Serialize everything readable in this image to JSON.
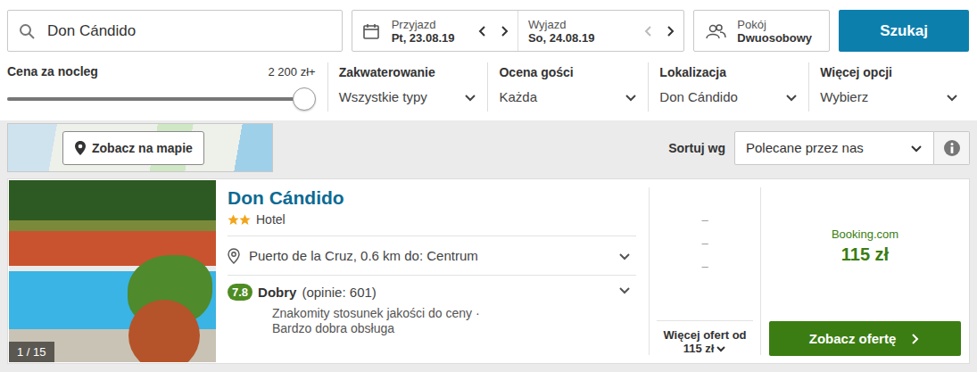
{
  "search": {
    "query": "Don Cándido"
  },
  "dates": [
    {
      "label": "Przyjazd",
      "value": "Pt, 23.08.19",
      "prev_disabled": false
    },
    {
      "label": "Wyjazd",
      "value": "So, 24.08.19",
      "prev_disabled": true
    }
  ],
  "room": {
    "label": "Pokój",
    "value": "Dwuosobowy"
  },
  "search_button": "Szukaj",
  "price_filter": {
    "label": "Cena za nocleg",
    "reading": "2 200 zł+",
    "level": 1
  },
  "filters": [
    {
      "label": "Zakwaterowanie",
      "value": "Wszystkie typy"
    },
    {
      "label": "Ocena gości",
      "value": "Każda"
    },
    {
      "label": "Lokalizacja",
      "value": "Don Cándido"
    },
    {
      "label": "Więcej opcji",
      "value": "Wybierz"
    }
  ],
  "map_button": "Zobacz na mapie",
  "sort": {
    "label": "Sortuj wg",
    "value": "Polecane przez nas"
  },
  "results": [
    {
      "name": "Don Cándido",
      "stars": 2,
      "type": "Hotel",
      "location": "Puerto de la Cruz, 0.6 km do: Centrum",
      "rating": "7.8",
      "rating_label": "Dobry",
      "reviews": "(opinie: 601)",
      "highlights": [
        "Znakomity stosunek jakości do ceny ·",
        "Bardzo dobra obsługa"
      ],
      "photo_counter": "1 / 15",
      "other_offers": [
        "–",
        "–",
        "–"
      ],
      "more_offers_label": "Więcej ofert od",
      "more_offers_price": "115 zł",
      "provider": "Booking.com",
      "price": "115 zł",
      "cta": "Zobacz ofertę"
    }
  ]
}
